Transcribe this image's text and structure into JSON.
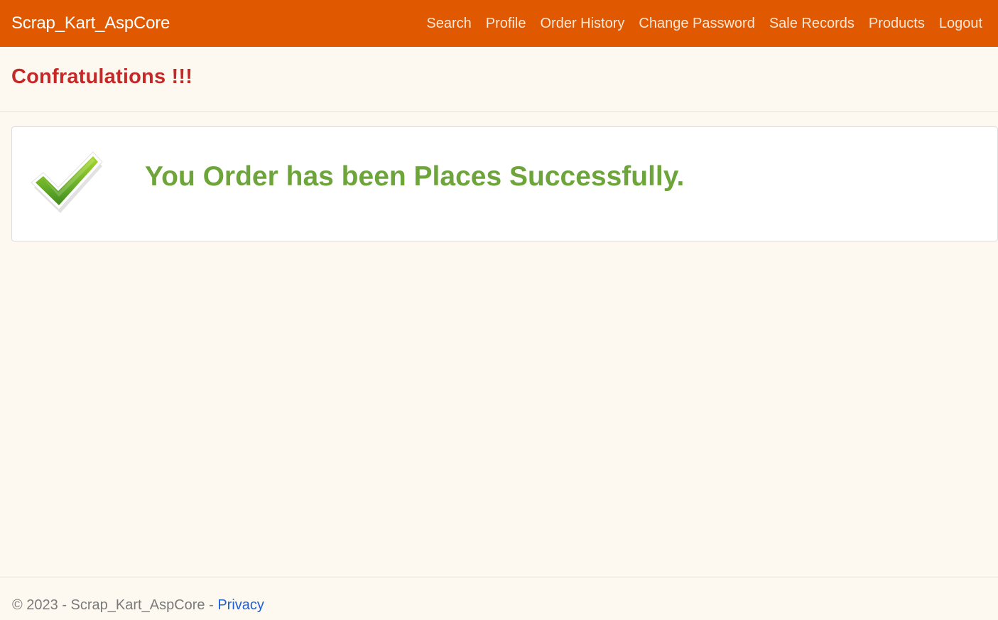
{
  "navbar": {
    "brand": "Scrap_Kart_AspCore",
    "links": [
      {
        "label": "Search"
      },
      {
        "label": "Profile"
      },
      {
        "label": "Order History"
      },
      {
        "label": "Change Password"
      },
      {
        "label": "Sale Records"
      },
      {
        "label": "Products"
      },
      {
        "label": "Logout"
      }
    ]
  },
  "page": {
    "title": "Confratulations !!!",
    "message": "You Order has been Places Successfully.",
    "icon": "checkmark-icon"
  },
  "footer": {
    "copyright": "© 2023 - Scrap_Kart_AspCore - ",
    "privacy_label": "Privacy"
  },
  "colors": {
    "navbar_bg": "#e05800",
    "title": "#c62828",
    "message": "#6ea53a",
    "link": "#1d5fd6",
    "page_bg": "#fef9f0"
  }
}
